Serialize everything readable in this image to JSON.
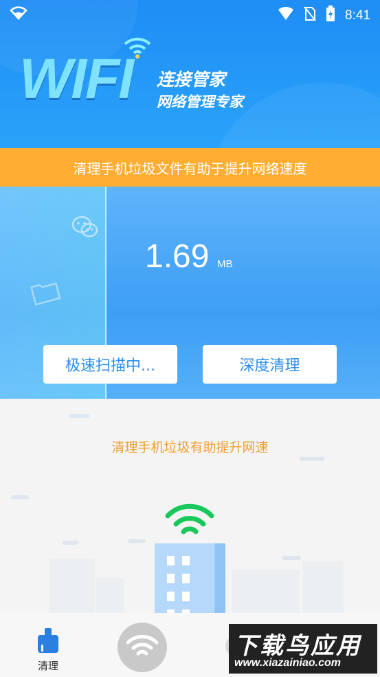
{
  "status_bar": {
    "time": "8:41",
    "icons": [
      "wifi-icon",
      "signal-icon",
      "no-sim-icon",
      "battery-charging-icon"
    ]
  },
  "header": {
    "logo_word": "WIFI",
    "title": "连接管家",
    "subtitle": "网络管理专家"
  },
  "banner": {
    "text": "清理手机垃圾文件有助于提升网络速度"
  },
  "scan": {
    "size_value": "1.69",
    "size_unit": "MB",
    "scan_button_label": "极速扫描中...",
    "deep_clean_button_label": "深度清理",
    "floating_icons": [
      "wechat-icon",
      "folder-icon"
    ]
  },
  "lower": {
    "tip": "清理手机垃圾有助提升网速"
  },
  "tabbar": {
    "items": [
      {
        "label": "清理",
        "icon": "broom-icon",
        "active": true
      },
      {
        "label": "",
        "icon": "wifi-icon",
        "active": false
      }
    ]
  },
  "watermark": {
    "title": "下载鸟应用",
    "url": "www.xiazainiao.com"
  },
  "colors": {
    "header_blue": "#1e8df5",
    "banner_orange": "#ffad33",
    "tip_orange": "#f0a030",
    "button_text_blue": "#2e8ef0",
    "tab_active_blue": "#2a7fe0",
    "wifi_green": "#18c85a"
  }
}
